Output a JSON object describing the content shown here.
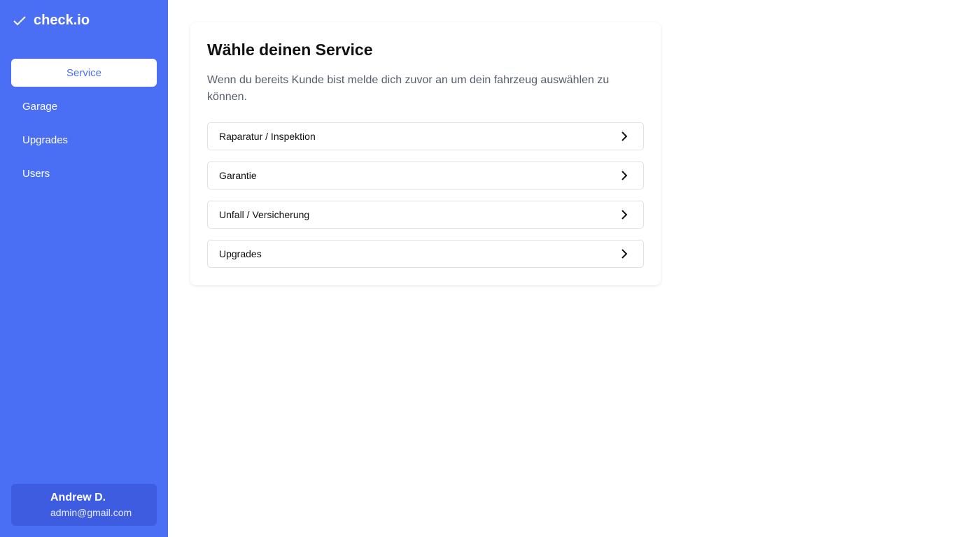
{
  "brand": {
    "name": "check.io",
    "icon": "check-icon"
  },
  "sidebar": {
    "items": [
      {
        "label": "Service",
        "active": true
      },
      {
        "label": "Garage"
      },
      {
        "label": "Upgrades"
      },
      {
        "label": "Users"
      }
    ]
  },
  "user": {
    "name": "Andrew D.",
    "email": "admin@gmail.com"
  },
  "main": {
    "title": "Wähle deinen Service",
    "description": "Wenn du bereits Kunde bist melde dich zuvor an um dein fahrzeug auswählen zu können.",
    "options": [
      {
        "label": "Raparatur / Inspektion"
      },
      {
        "label": "Garantie"
      },
      {
        "label": "Unfall / Versicherung"
      },
      {
        "label": "Upgrades"
      }
    ]
  },
  "colors": {
    "sidebar": "#4a6ff5",
    "user_card": "#3d5ce0"
  }
}
